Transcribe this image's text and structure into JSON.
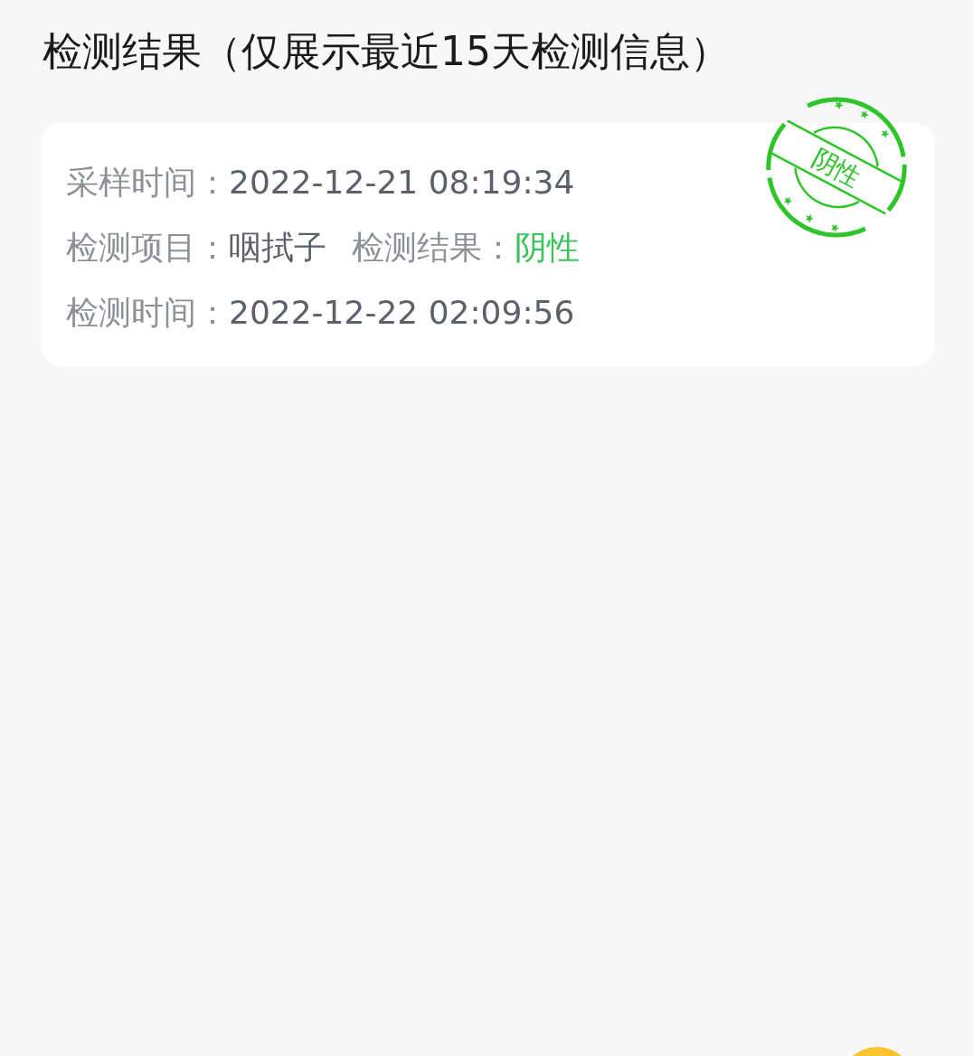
{
  "title": "检测结果（仅展示最近15天检测信息）",
  "record": {
    "rows": [
      {
        "fields": [
          {
            "label": "采样时间：",
            "value": "2022-12-21 08:19:34"
          }
        ]
      },
      {
        "fields": [
          {
            "label": "检测项目：",
            "value": "咽拭子"
          },
          {
            "label": "检测结果：",
            "value": "阴性",
            "color": "#3cc35c"
          }
        ]
      },
      {
        "fields": [
          {
            "label": "检测时间：",
            "value": "2022-12-22 02:09:56"
          }
        ]
      }
    ],
    "stamp": {
      "text": "阴性",
      "color": "#2ec52b"
    }
  }
}
